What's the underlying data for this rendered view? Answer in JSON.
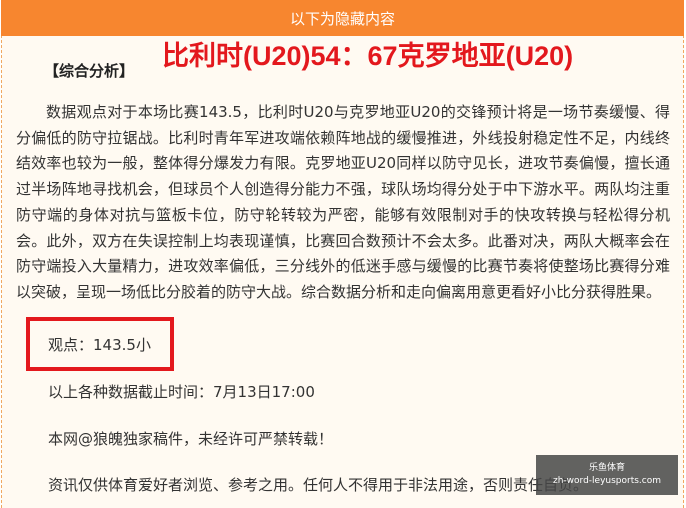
{
  "header": {
    "label": "以下为隐藏内容"
  },
  "title": "比利时(U20)54：67克罗地亚(U20)",
  "section_title": "【综合分析】",
  "paragraph": "数据观点对于本场比赛143.5，比利时U20与克罗地亚U20的交锋预计将是一场节奏缓慢、得分偏低的防守拉锯战。比利时青年军进攻端依赖阵地战的缓慢推进，外线投射稳定性不足，内线终结效率也较为一般，整体得分爆发力有限。克罗地亚U20同样以防守见长，进攻节奏偏慢，擅长通过半场阵地寻找机会，但球员个人创造得分能力不强，球队场均得分处于中下游水平。两队均注重防守端的身体对抗与篮板卡位，防守轮转较为严密，能够有效限制对手的快攻转换与轻松得分机会。此外，双方在失误控制上均表现谨慎，比赛回合数预计不会太多。此番对决，两队大概率会在防守端投入大量精力，进攻效率偏低，三分线外的低迷手感与缓慢的比赛节奏将使整场比赛得分难以突破，呈现一场低比分胶着的防守大战。综合数据分析和走向偏离用意更看好小比分获得胜果。",
  "viewpoint": "观点：143.5小",
  "deadline": "以上各种数据截止时间：7月13日17:00",
  "copyright": "本网@狼魄独家稿件，未经许可严禁转载！",
  "disclaimer": "资讯仅供体育爱好者浏览、参考之用。任何人不得用于非法用途，否则责任自负。",
  "watermark": {
    "line1": "乐鱼体育",
    "line2": "zh-word-leyusports.com"
  }
}
